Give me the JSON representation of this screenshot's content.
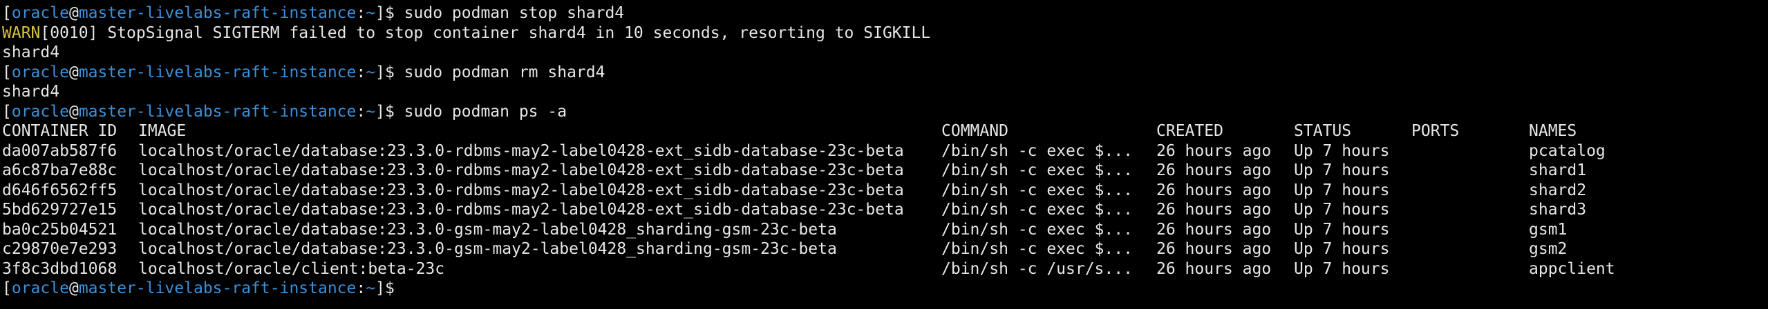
{
  "prompt": {
    "open_bracket": "[",
    "user": "oracle",
    "at": "@",
    "host": "master-livelabs-raft-instance",
    "colon": ":",
    "path": "~",
    "close_bracket": "]",
    "dollar": "$ "
  },
  "cmd1": "sudo podman stop shard4",
  "warn_label": "WARN",
  "warn_rest": "[0010] StopSignal SIGTERM failed to stop container shard4 in 10 seconds, resorting to SIGKILL",
  "out1": "shard4",
  "cmd2": "sudo podman rm shard4",
  "out2": "shard4",
  "cmd3": "sudo podman ps -a",
  "table": {
    "headers": {
      "id": "CONTAINER ID",
      "image": "IMAGE",
      "command": "COMMAND",
      "created": "CREATED",
      "status": "STATUS",
      "ports": "PORTS",
      "names": "NAMES"
    },
    "rows": [
      {
        "id": "da007ab587f6",
        "image": "localhost/oracle/database:23.3.0-rdbms-may2-label0428-ext_sidb-database-23c-beta",
        "command": "/bin/sh -c exec $...",
        "created": "26 hours ago",
        "status": "Up 7 hours",
        "ports": "",
        "names": "pcatalog"
      },
      {
        "id": "a6c87ba7e88c",
        "image": "localhost/oracle/database:23.3.0-rdbms-may2-label0428-ext_sidb-database-23c-beta",
        "command": "/bin/sh -c exec $...",
        "created": "26 hours ago",
        "status": "Up 7 hours",
        "ports": "",
        "names": "shard1"
      },
      {
        "id": "d646f6562ff5",
        "image": "localhost/oracle/database:23.3.0-rdbms-may2-label0428-ext_sidb-database-23c-beta",
        "command": "/bin/sh -c exec $...",
        "created": "26 hours ago",
        "status": "Up 7 hours",
        "ports": "",
        "names": "shard2"
      },
      {
        "id": "5bd629727e15",
        "image": "localhost/oracle/database:23.3.0-rdbms-may2-label0428-ext_sidb-database-23c-beta",
        "command": "/bin/sh -c exec $...",
        "created": "26 hours ago",
        "status": "Up 7 hours",
        "ports": "",
        "names": "shard3"
      },
      {
        "id": "ba0c25b04521",
        "image": "localhost/oracle/database:23.3.0-gsm-may2-label0428_sharding-gsm-23c-beta",
        "command": "/bin/sh -c exec $...",
        "created": "26 hours ago",
        "status": "Up 7 hours",
        "ports": "",
        "names": "gsm1"
      },
      {
        "id": "c29870e7e293",
        "image": "localhost/oracle/database:23.3.0-gsm-may2-label0428_sharding-gsm-23c-beta",
        "command": "/bin/sh -c exec $...",
        "created": "26 hours ago",
        "status": "Up 7 hours",
        "ports": "",
        "names": "gsm2"
      },
      {
        "id": "3f8c3dbd1068",
        "image": "localhost/oracle/client:beta-23c",
        "command": "/bin/sh -c /usr/s...",
        "created": "26 hours ago",
        "status": "Up 7 hours",
        "ports": "",
        "names": "appclient"
      }
    ]
  },
  "colors": {
    "background": "#000000",
    "text": "#e6e6e6",
    "prompt_blue": "#3d8fd6",
    "warn_yellow": "#d8c33a"
  }
}
